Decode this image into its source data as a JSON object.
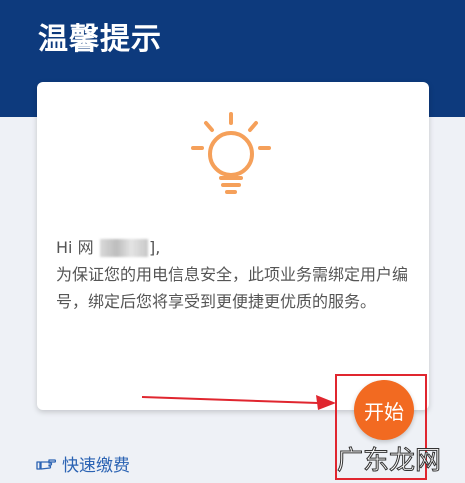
{
  "page": {
    "title": "温馨提示"
  },
  "card": {
    "greeting_prefix": "Hi 网",
    "greeting_suffix": "],",
    "body": "为保证您的用电信息安全，此项业务需绑定用户编号，绑定后您将享受到更便捷更优质的服务。"
  },
  "actions": {
    "start_label": "开始",
    "quick_pay_label": "快速缴费"
  },
  "watermark": {
    "text": "广东龙网"
  },
  "icons": {
    "bulb": "lightbulb-icon",
    "quick_pay": "pointing-hand-icon"
  },
  "colors": {
    "header": "#0d3a7d",
    "accent": "#f26a21",
    "link": "#2b63b3",
    "annotation": "#e0262f"
  }
}
